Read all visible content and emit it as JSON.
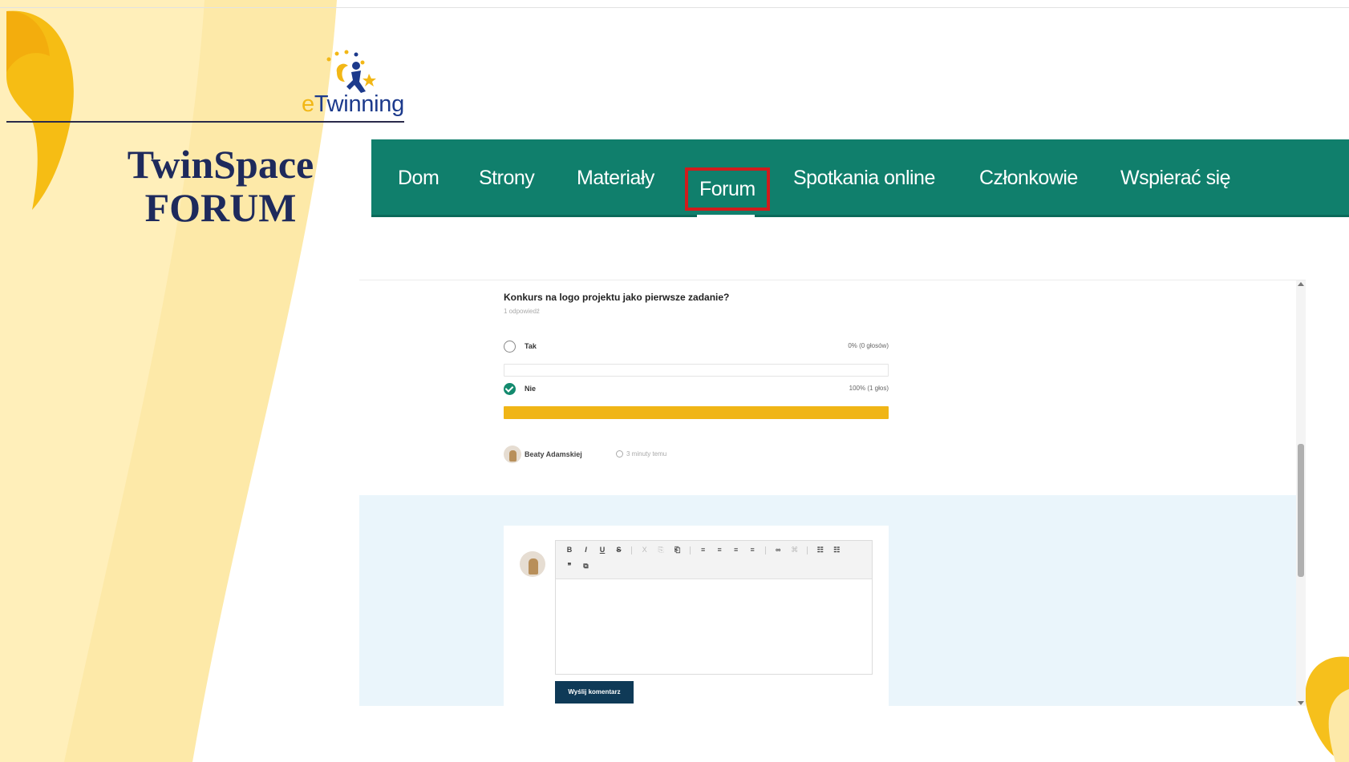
{
  "slide": {
    "title_line1": "TwinSpace",
    "title_line2": "FORUM",
    "logo_e": "e",
    "logo_rest": "Twinning"
  },
  "nav": {
    "items": [
      {
        "label": "Dom"
      },
      {
        "label": "Strony"
      },
      {
        "label": "Materiały"
      },
      {
        "label": "Forum",
        "active": true
      },
      {
        "label": "Spotkania online"
      },
      {
        "label": "Członkowie"
      },
      {
        "label": "Wspierać się"
      }
    ],
    "bg_color": "#107f6c",
    "highlight_color": "#d01c1c"
  },
  "poll": {
    "question": "Konkurs na logo projektu jako pierwsze zadanie?",
    "answers_count": "1 odpowiedź",
    "options": [
      {
        "label": "Tak",
        "value_text": "0% (0 głosów)",
        "percent": 0,
        "selected": false
      },
      {
        "label": "Nie",
        "value_text": "100% (1 głos)",
        "percent": 100,
        "selected": true
      }
    ],
    "bar_color": "#f0b516"
  },
  "author": {
    "name": "Beaty Adamskiej",
    "time": "3 minuty temu"
  },
  "editor": {
    "toolbar_row1": [
      "B",
      "I",
      "U",
      "S",
      "X",
      "⎘",
      "⎗",
      "≡",
      "≡",
      "≡",
      "≡",
      "∞",
      "⌘",
      "☷",
      "☷"
    ],
    "toolbar_row2": [
      "❞",
      "⧉"
    ],
    "submit_label": "Wyślij komentarz"
  }
}
